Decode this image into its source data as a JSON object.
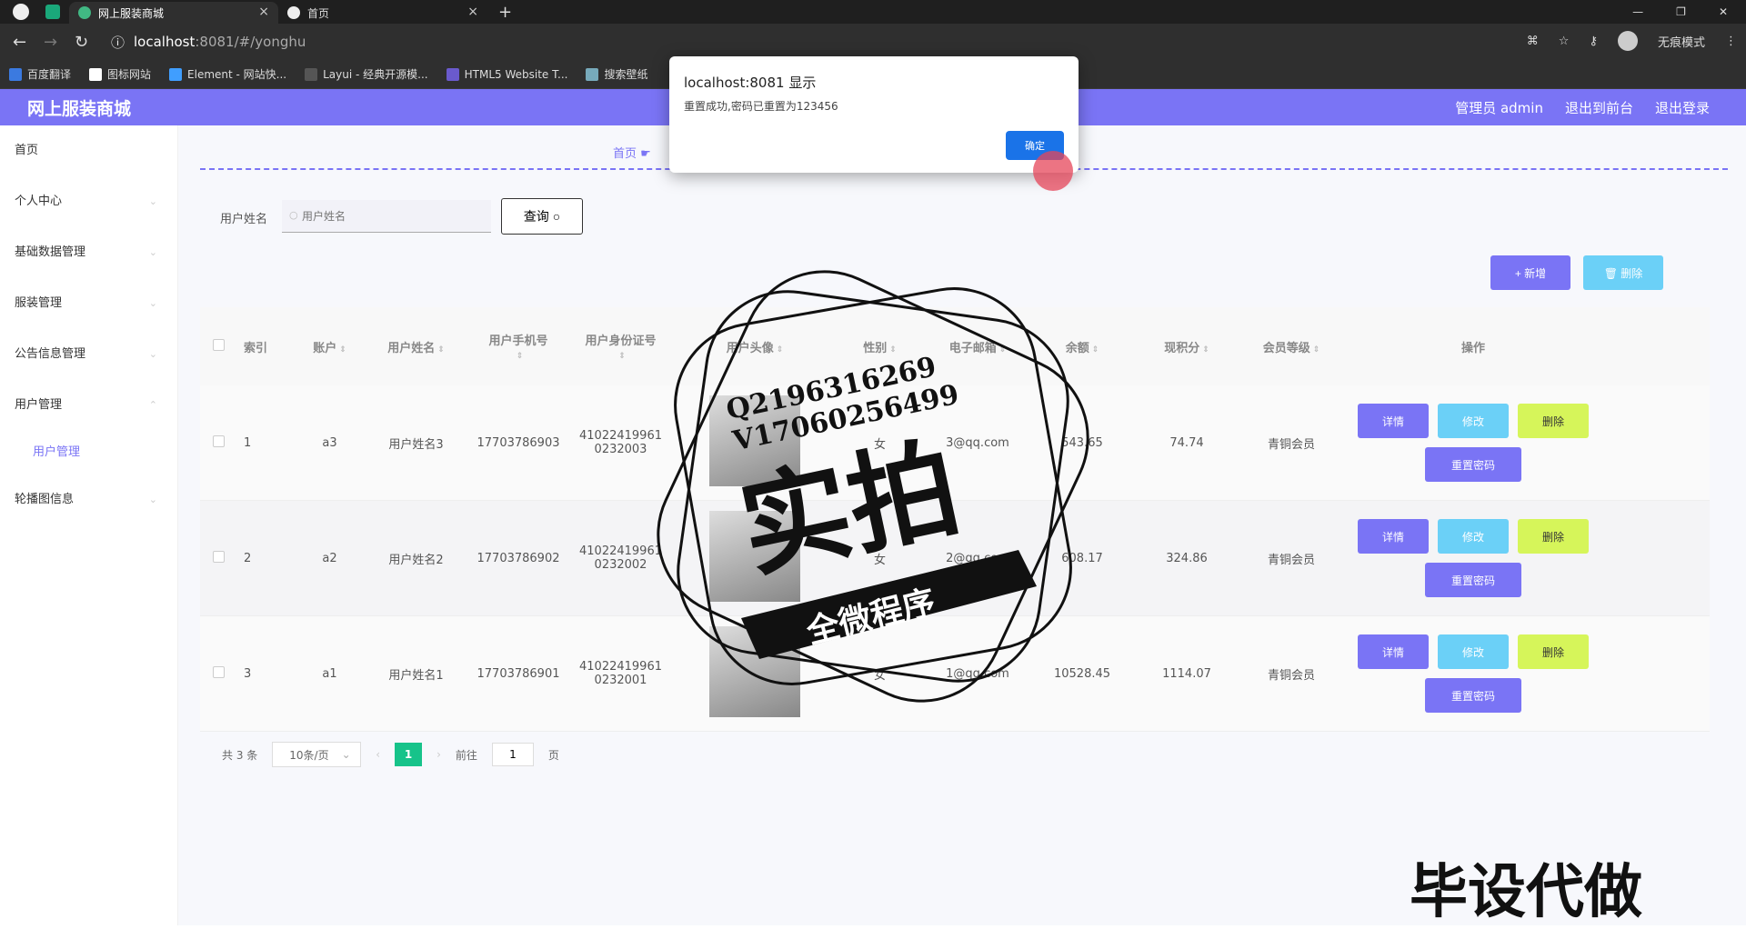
{
  "browser": {
    "tabs": [
      {
        "label": "网上服装商城",
        "active": true
      },
      {
        "label": "首页",
        "active": false
      }
    ],
    "url_host": "localhost",
    "url_path": ":8081/#/yonghu",
    "incognito_label": "无痕模式",
    "bookmarks": [
      "百度翻译",
      "图标网站",
      "Element - 网站快...",
      "Layui - 经典开源模...",
      "HTML5 Website T...",
      "搜索壁纸"
    ]
  },
  "header": {
    "brand": "网上服装商城",
    "admin_label": "管理员 admin",
    "to_front_label": "退出到前台",
    "logout_label": "退出登录",
    "accent": "#7a74f5"
  },
  "sidebar": {
    "items": [
      {
        "label": "首页"
      },
      {
        "label": "个人中心"
      },
      {
        "label": "基础数据管理"
      },
      {
        "label": "服装管理"
      },
      {
        "label": "公告信息管理"
      },
      {
        "label": "用户管理"
      },
      {
        "label": "用户管理"
      },
      {
        "label": "轮播图信息"
      }
    ]
  },
  "breadcrumb": "首页",
  "search": {
    "label": "用户姓名",
    "placeholder": "用户姓名",
    "query_label": "查询"
  },
  "toolbar": {
    "add_label": "+ 新增",
    "delete_label": "删除"
  },
  "table": {
    "headers": [
      "索引",
      "账户",
      "用户姓名",
      "用户手机号",
      "用户身份证号",
      "用户头像",
      "性别",
      "电子邮箱",
      "余额",
      "现积分",
      "会员等级",
      "操作"
    ],
    "rows": [
      {
        "index": "1",
        "account": "a3",
        "name": "用户姓名3",
        "phone": "17703786903",
        "id1": "41022419961",
        "id2": "0232003",
        "gender": "女",
        "email": "3@qq.com",
        "balance": "543.65",
        "points": "74.74",
        "level": "青铜会员"
      },
      {
        "index": "2",
        "account": "a2",
        "name": "用户姓名2",
        "phone": "17703786902",
        "id1": "41022419961",
        "id2": "0232002",
        "gender": "女",
        "email": "2@qq.com",
        "balance": "608.17",
        "points": "324.86",
        "level": "青铜会员"
      },
      {
        "index": "3",
        "account": "a1",
        "name": "用户姓名1",
        "phone": "17703786901",
        "id1": "41022419961",
        "id2": "0232001",
        "gender": "女",
        "email": "1@qq.com",
        "balance": "10528.45",
        "points": "1114.07",
        "level": "青铜会员"
      }
    ],
    "ops": {
      "detail": "详情",
      "edit": "修改",
      "delete": "删除",
      "reset": "重置密码"
    }
  },
  "pager": {
    "total": "共 3 条",
    "page_size": "10条/页",
    "current": "1",
    "goto_label": "前往",
    "goto_value": "1",
    "page_unit": "页"
  },
  "dialog": {
    "title": "localhost:8081 显示",
    "message": "重置成功,密码已重置为123456",
    "ok_label": "确定"
  },
  "watermark": {
    "line1": "Q2196316269",
    "line2": "V17060256499",
    "big": "实拍",
    "banner": "全微程序",
    "corner": "毕设代做"
  }
}
